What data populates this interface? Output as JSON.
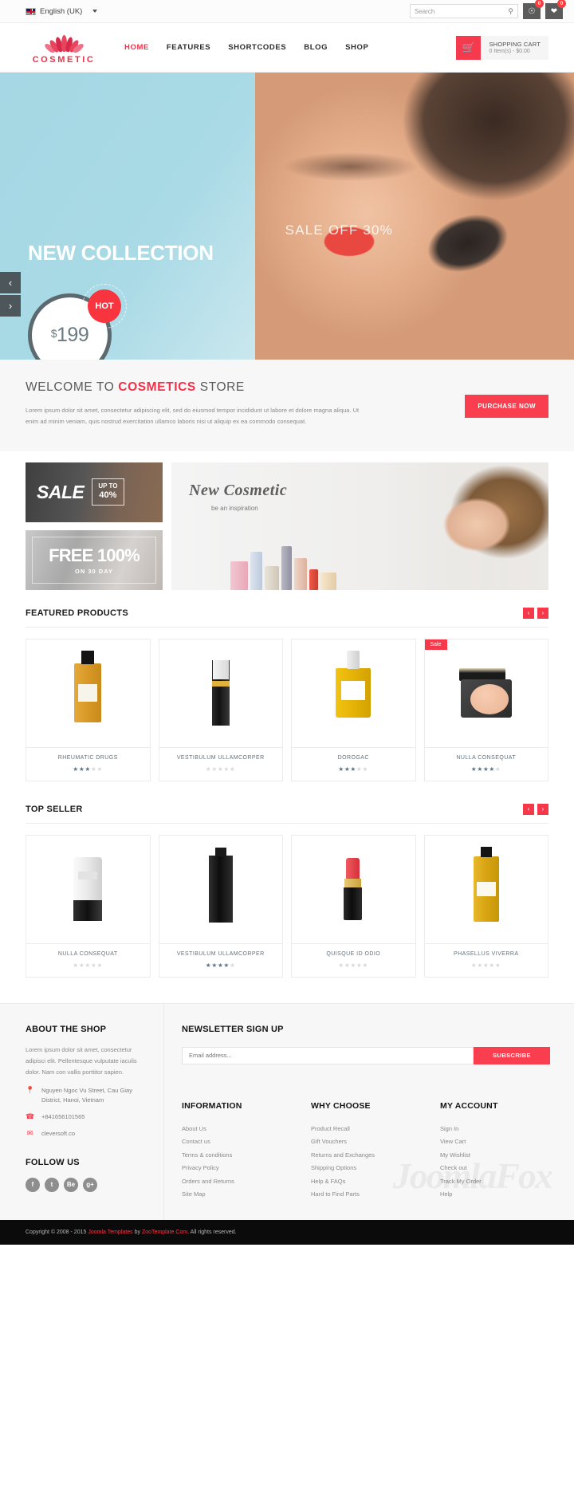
{
  "topbar": {
    "language": "English (UK)",
    "search_placeholder": "Search",
    "compare_badge": "0",
    "wishlist_badge": "0"
  },
  "header": {
    "brand": "COSMETIC",
    "nav": [
      {
        "label": "HOME",
        "active": true
      },
      {
        "label": "FEATURES",
        "active": false
      },
      {
        "label": "SHORTCODES",
        "active": false
      },
      {
        "label": "BLOG",
        "active": false
      },
      {
        "label": "SHOP",
        "active": false
      }
    ],
    "cart_title": "SHOPPING CART",
    "cart_sub": "0 Item(s) - $0.00"
  },
  "hero": {
    "sale_off": "SALE OFF 30%",
    "title": "NEW COLLECTION",
    "price_currency": "$",
    "price_value": "199",
    "hot_label": "HOT",
    "prev": "‹",
    "next": "›"
  },
  "welcome": {
    "title_pre": "WELCOME TO",
    "title_brand": "COSMETICS",
    "title_post": "STORE",
    "paragraph": "Lorem ipsum dolor sit amet, consectetur adipiscing elit, sed do eiusmod tempor incididunt ut labore et dolore magna aliqua. Ut enim ad minim veniam, quis nostrud exercitation ullamco laboris nisi ut aliquip ex ea commodo consequat.",
    "button": "PURCHASE NOW"
  },
  "promo": {
    "sale_word": "SALE",
    "sale_upto": "UP TO",
    "sale_percent": "40%",
    "free_word": "FREE 100%",
    "free_sub": "ON 30 DAY",
    "new_cosmetic_title": "New Cosmetic",
    "new_cosmetic_sub": "be an inspiration"
  },
  "featured": {
    "title": "FEATURED PRODUCTS",
    "prev": "‹",
    "next": "›",
    "products": [
      {
        "name": "RHEUMATIC DRUGS",
        "rating": 3,
        "sale": false
      },
      {
        "name": "VESTIBULUM ULLAMCORPER",
        "rating": 0,
        "sale": false
      },
      {
        "name": "DOROGAC",
        "rating": 3,
        "sale": false
      },
      {
        "name": "NULLA CONSEQUAT",
        "rating": 4,
        "sale": true,
        "sale_label": "Sale"
      }
    ]
  },
  "topseller": {
    "title": "TOP SELLER",
    "prev": "‹",
    "next": "›",
    "products": [
      {
        "name": "NULLA CONSEQUAT",
        "rating": 0
      },
      {
        "name": "VESTIBULUM ULLAMCORPER",
        "rating": 4
      },
      {
        "name": "QUISQUE ID ODIO",
        "rating": 0
      },
      {
        "name": "PHASELLUS VIVERRA",
        "rating": 0
      }
    ]
  },
  "footer": {
    "about_title": "ABOUT THE SHOP",
    "about_text": "Lorem ipsum dolor sit amet, consectetur adipisci elit. Pellentesque vulputate iaculis dolor. Nam con vallis porttitor sapien.",
    "address": "Nguyen Ngoc Vu Street, Cau Giay District, Hanoi, Vietnam",
    "phone": "+841656101565",
    "email": "cleversoft.co",
    "follow_title": "FOLLOW US",
    "socials": [
      "f",
      "t",
      "Be",
      "g+"
    ],
    "newsletter_title": "NEWSLETTER SIGN UP",
    "newsletter_placeholder": "Email address...",
    "newsletter_button": "SUBSCRIBE",
    "columns": [
      {
        "title": "INFORMATION",
        "links": [
          "About Us",
          "Contact us",
          "Terms & conditions",
          "Privacy Policy",
          "Orders and Returns",
          "Site Map"
        ]
      },
      {
        "title": "WHY CHOOSE",
        "links": [
          "Product Recall",
          "Gift Vouchers",
          "Returns and Exchanges",
          "Shipping Options",
          "Help & FAQs",
          "Hard to Find Parts"
        ]
      },
      {
        "title": "MY ACCOUNT",
        "links": [
          "Sign In",
          "View Cart",
          "My Wishlist",
          "Check out",
          "Track My Order",
          "Help"
        ]
      }
    ],
    "copyright_pre": "Copyright © 2008 - 2015",
    "copyright_link1": "Joomla Templates",
    "copyright_by": "by",
    "copyright_link2": "ZooTemplate.Com",
    "copyright_post": ". All rights reserved.",
    "watermark": "JoomlaFox"
  },
  "colors": {
    "accent": "#f5394b",
    "hero_bg": "#a5d8e4",
    "dark": "#0b0b0b"
  }
}
